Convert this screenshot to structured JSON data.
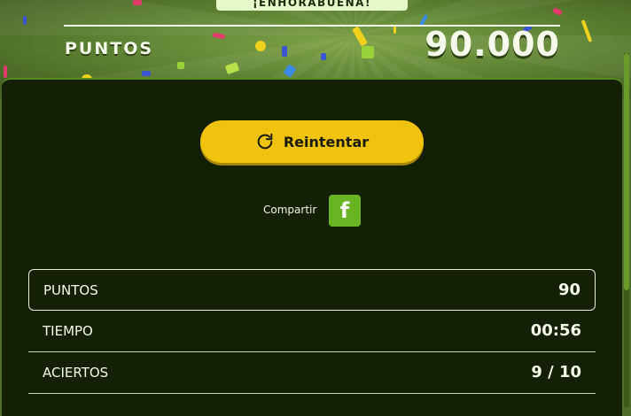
{
  "banner": {
    "congrats_text": "¡ENHORABUENA!",
    "score_label": "PUNTOS",
    "score_value": "90.000"
  },
  "actions": {
    "retry_label": "Reintentar",
    "share_label": "Compartir",
    "facebook_icon": "facebook-f"
  },
  "stats": [
    {
      "label": "PUNTOS",
      "value": "90"
    },
    {
      "label": "TIEMPO",
      "value": "00:56"
    },
    {
      "label": "ACIERTOS",
      "value": "9 / 10"
    }
  ],
  "colors": {
    "accent_yellow": "#f0c30f",
    "facebook_green": "#6ab423",
    "panel_bg": "#132006",
    "banner_green": "#5f8434"
  }
}
